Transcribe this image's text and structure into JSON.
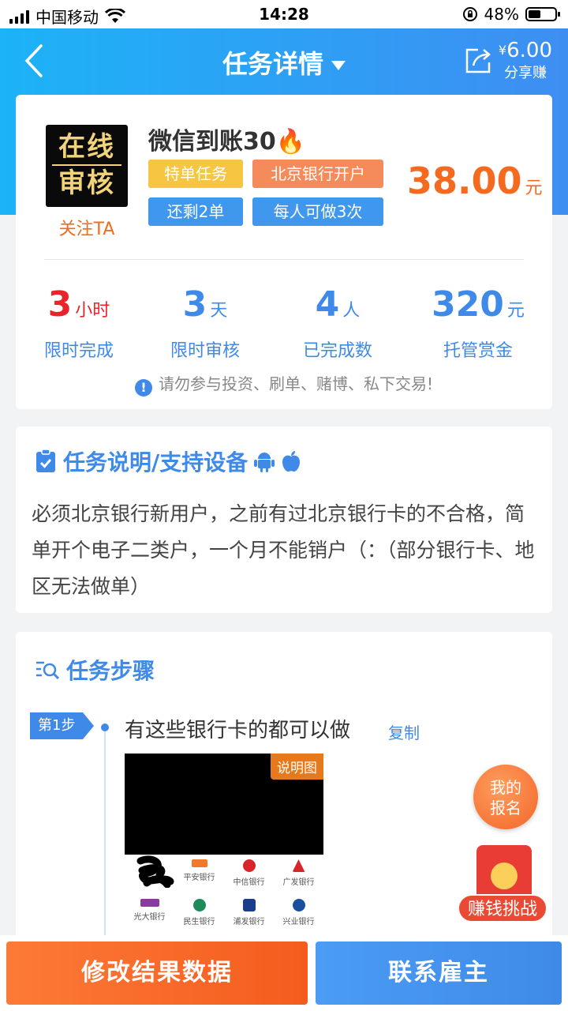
{
  "status_bar": {
    "carrier": "中国移动",
    "time": "14:28",
    "battery_text": "48%",
    "battery_level": 0.48
  },
  "nav": {
    "title": "任务详情",
    "share_currency": "¥",
    "share_amount": "6.00",
    "share_label": "分享赚"
  },
  "task": {
    "avatar_text_line1": "在线",
    "avatar_text_line2": "审核",
    "follow_label": "关注TA",
    "title": "微信到账30",
    "title_emoji": "🔥",
    "tags": [
      {
        "label": "特单任务",
        "color": "#f6c541"
      },
      {
        "label": "北京银行开户",
        "color": "#f58a5a"
      },
      {
        "label": "还剩2单",
        "color": "#3f98ee"
      },
      {
        "label": "每人可做3次",
        "color": "#3f98ee"
      }
    ],
    "price": "38.00",
    "price_unit": "元"
  },
  "stats": [
    {
      "value": "3",
      "unit": "小时",
      "label": "限时完成",
      "color": "#e8232a"
    },
    {
      "value": "3",
      "unit": "天",
      "label": "限时审核",
      "color": "#3f8ae8"
    },
    {
      "value": "4",
      "unit": "人",
      "label": "已完成数",
      "color": "#3f8ae8"
    },
    {
      "value": "320",
      "unit": "元",
      "label": "托管赏金",
      "color": "#3f8ae8"
    }
  ],
  "warning": "请勿参与投资、刷单、赌博、私下交易!",
  "description": {
    "title": "任务说明/支持设备",
    "text": "必须北京银行新用户，之前有过北京银行卡的不合格，简单开个电子二类户，一个月不能销户（：（部分银行卡、地区无法做单）"
  },
  "steps": {
    "title": "任务步骤",
    "items": [
      {
        "badge": "第1步",
        "text": "有这些银行卡的都可以做",
        "copy_label": "复制",
        "image_badge": "说明图",
        "banks": [
          "平安银行",
          "中信银行",
          "广发银行",
          "光大银行",
          "民生银行",
          "浦发银行",
          "兴业银行"
        ]
      }
    ]
  },
  "floating": {
    "signup_line1": "我的",
    "signup_line2": "报名",
    "challenge_label": "赚钱挑战"
  },
  "bottom": {
    "modify_label": "修改结果数据",
    "contact_label": "联系雇主"
  },
  "colors": {
    "primary_blue": "#3f8ae8",
    "accent_orange": "#f46a1f",
    "header_gradient_start": "#1cb3f7",
    "header_gradient_end": "#3e8ef2"
  }
}
